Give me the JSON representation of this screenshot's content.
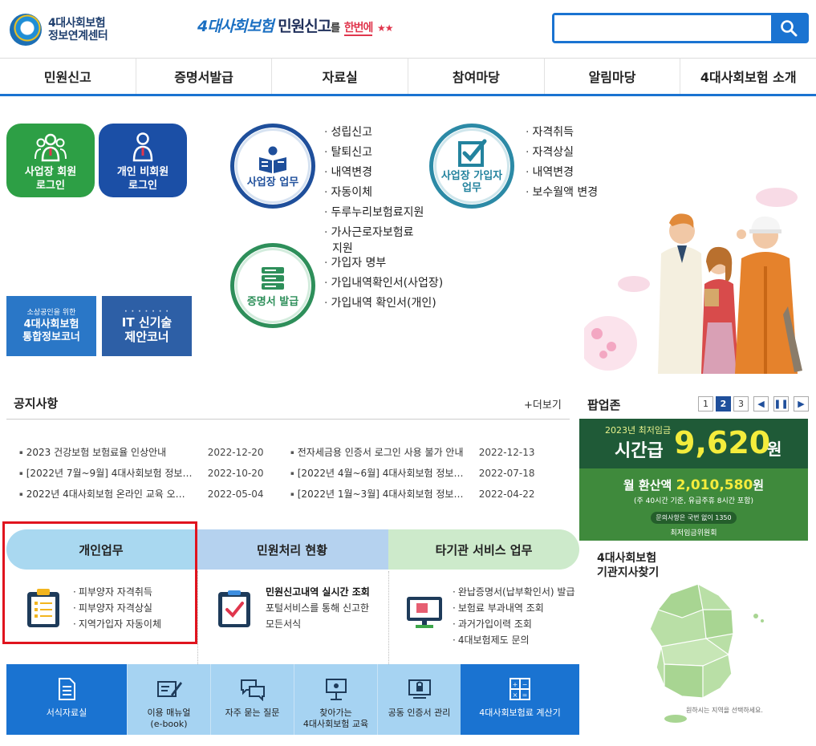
{
  "header": {
    "logo_line1": "4대사회보험",
    "logo_line2": "정보연계센터",
    "slogan_part1": "4대사회보험",
    "slogan_part2": "민원신고",
    "slogan_part3": "를",
    "slogan_part4": "한번에",
    "search_placeholder": "",
    "search_value": ""
  },
  "nav": [
    "민원신고",
    "증명서발급",
    "자료실",
    "참여마당",
    "알림마당",
    "4대사회보험 소개"
  ],
  "login": {
    "biz_line1": "사업장 회원",
    "biz_line2": "로그인",
    "indiv_line1": "개인 비회원",
    "indiv_line2": "로그인"
  },
  "banners": {
    "small_line1": "소상공인을 위한",
    "small_line2": "4대사회보험",
    "small_line3": "통합정보코너",
    "it_line1": "IT 신기술",
    "it_line2": "제안코너"
  },
  "business": {
    "label": "사업장 업무",
    "links": [
      "성립신고",
      "탈퇴신고",
      "내역변경",
      "자동이체",
      "두루누리보험료지원",
      "가사근로자보험료",
      "지원"
    ]
  },
  "join": {
    "label_line1": "사업장 가입자",
    "label_line2": "업무",
    "links": [
      "자격취득",
      "자격상실",
      "내역변경",
      "보수월액 변경"
    ]
  },
  "cert": {
    "label": "증명서 발급",
    "links": [
      "가입자 명부",
      "가입내역확인서(사업장)",
      "가입내역 확인서(개인)"
    ]
  },
  "notice": {
    "title": "공지사항",
    "more": "+더보기",
    "left": [
      {
        "title": "2023 건강보험 보험료율 인상안내",
        "date": "2022-12-20"
      },
      {
        "title": "[2022년 7월~9월] 4대사회보험 정보…",
        "date": "2022-10-20"
      },
      {
        "title": "2022년 4대사회보험 온라인 교육 오…",
        "date": "2022-05-04"
      }
    ],
    "right": [
      {
        "title": "전자세금용 인증서 로그인 사용 불가 안내",
        "date": "2022-12-13"
      },
      {
        "title": "[2022년 4월~6월] 4대사회보험 정보…",
        "date": "2022-07-18"
      },
      {
        "title": "[2022년 1월~3월] 4대사회보험 정보…",
        "date": "2022-04-22"
      }
    ]
  },
  "popup": {
    "title": "팝업존",
    "pages": [
      "1",
      "2",
      "3"
    ],
    "active_page": "2",
    "year_label": "2023년 최저임금",
    "hourly_label": "시간급",
    "hourly_value": "9,620",
    "won": "원",
    "month_label": "월 환산액",
    "month_value": "2,010,580",
    "month_won": "원",
    "month_note": "(주 40시간 기준, 유급주휴 8시간 포함)",
    "question": "문의사항은 국번 없이 1350",
    "org": "최저임금위원회"
  },
  "service": {
    "tabs": [
      "개인업무",
      "민원처리 현황",
      "타기관 서비스 업무"
    ],
    "indiv_links": [
      "피부양자 자격취득",
      "피부양자 자격상실",
      "지역가입자 자동이체"
    ],
    "status_title": "민원신고내역 실시간 조회",
    "status_desc1": "포털서비스를 통해 신고한",
    "status_desc2": "모든서식",
    "other_links": [
      "완납증명서(납부확인서) 발급",
      "보험료 부과내역 조회",
      "과거가입이력 조회",
      "4대보험제도 문의"
    ]
  },
  "quick": [
    {
      "label": "서식자료실",
      "sub": ""
    },
    {
      "label": "이용 매뉴얼",
      "sub": "(e-book)"
    },
    {
      "label": "자주 묻는 질문",
      "sub": ""
    },
    {
      "label": "찾아가는",
      "sub": "4대사회보험 교육"
    },
    {
      "label": "공동 인증서 관리",
      "sub": ""
    },
    {
      "label": "4대사회보험료 계산기",
      "sub": ""
    }
  ],
  "branch": {
    "title_line1": "4대사회보험",
    "title_line2": "기관지사찾기",
    "note": "원하시는 지역을 선택하세요."
  },
  "colors": {
    "brand_blue": "#1a73d1",
    "green": "#2d9f45",
    "highlight_red": "#e0141e"
  }
}
